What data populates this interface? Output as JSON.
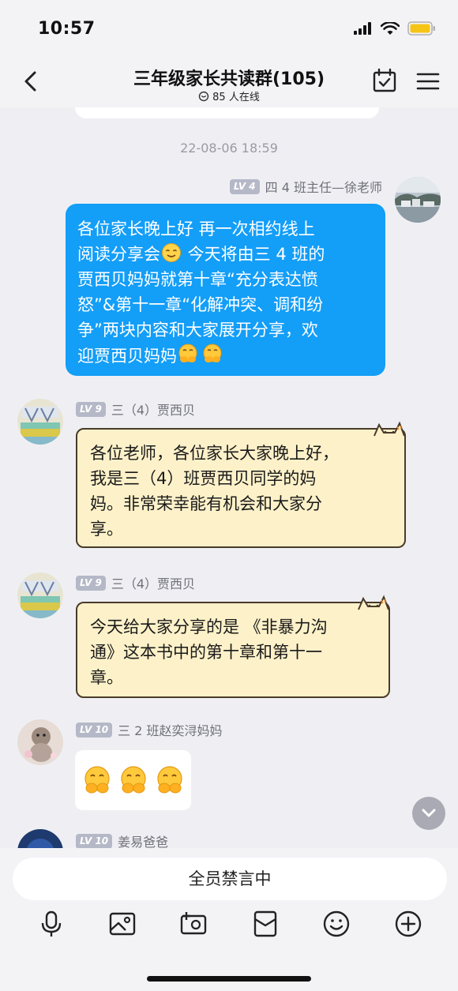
{
  "status_bar": {
    "time": "10:57"
  },
  "header": {
    "title": "三年级家长共读群(105)",
    "online": "85 人在线"
  },
  "chat": {
    "timestamp": "22-08-06 18:59",
    "messages": [
      {
        "level": "LV 4",
        "sender": "四 4 班主任—徐老师",
        "line1": "各位家长晚上好 再一次相约线上",
        "line2a": "阅读分享会",
        "line2b": " 今天将由三 4 班的",
        "line3": "贾西贝妈妈就第十章“充分表达愤",
        "line4": "怒”&第十一章“化解冲突、调和纷",
        "line5": "争”两块内容和大家展开分享，欢",
        "line6": "迎贾西贝妈妈"
      },
      {
        "level": "LV 9",
        "sender": "三（4）贾西贝",
        "lines": [
          "各位老师，各位家长大家晚上好，",
          "我是三（4）班贾西贝同学的妈",
          "妈。非常荣幸能有机会和大家分",
          "享。"
        ]
      },
      {
        "level": "LV 9",
        "sender": "三（4）贾西贝",
        "lines": [
          "今天给大家分享的是 《非暴力沟",
          "通》这本书中的第十章和第十一",
          "章。"
        ]
      },
      {
        "level": "LV 10",
        "sender": "三 2 班赵奕浔妈妈"
      },
      {
        "level": "LV 10",
        "sender": "姜易爸爸"
      }
    ]
  },
  "input": {
    "muted_label": "全员禁言中"
  },
  "icons": {
    "back": "chevron-left-icon",
    "calendar": "calendar-check-icon",
    "menu": "hamburger-menu-icon",
    "toolbar": [
      "microphone-icon",
      "image-icon",
      "camera-icon",
      "red-packet-icon",
      "emoji-icon",
      "plus-icon"
    ]
  },
  "colors": {
    "accent_blue": "#139ef8",
    "cat_bubble": "#fdf1c9",
    "badge": "#b5b8c7"
  }
}
